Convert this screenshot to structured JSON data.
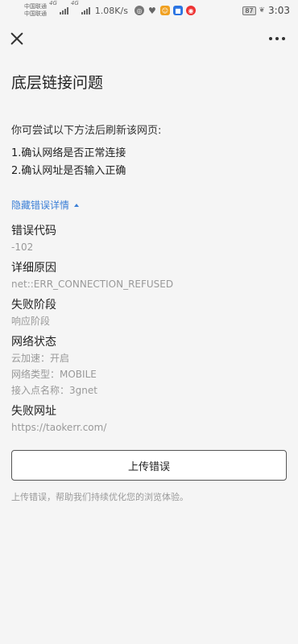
{
  "status_bar": {
    "carrier1": "中国联通",
    "carrier2": "中国联通",
    "hd1": "4G",
    "hd2": "4G",
    "speed": "1.08K/s",
    "battery": "87",
    "time": "3:03"
  },
  "page": {
    "title": "底层链接问题",
    "suggest_heading": "你可尝试以下方法后刷新该网页:",
    "suggestions": [
      "1.确认网络是否正常连接",
      "2.确认网址是否输入正确"
    ],
    "toggle_label": "隐藏错误详情"
  },
  "details": {
    "code_label": "错误代码",
    "code_value": "-102",
    "reason_label": "详细原因",
    "reason_value": "net::ERR_CONNECTION_REFUSED",
    "stage_label": "失败阶段",
    "stage_value": "响应阶段",
    "network_label": "网络状态",
    "network_values": [
      "云加速：开启",
      "网络类型：MOBILE",
      "接入点名称：3gnet"
    ],
    "url_label": "失败网址",
    "url_value": "https://taokerr.com/"
  },
  "actions": {
    "upload_label": "上传错误",
    "upload_hint": "上传错误，帮助我们持续优化您的浏览体验。"
  }
}
